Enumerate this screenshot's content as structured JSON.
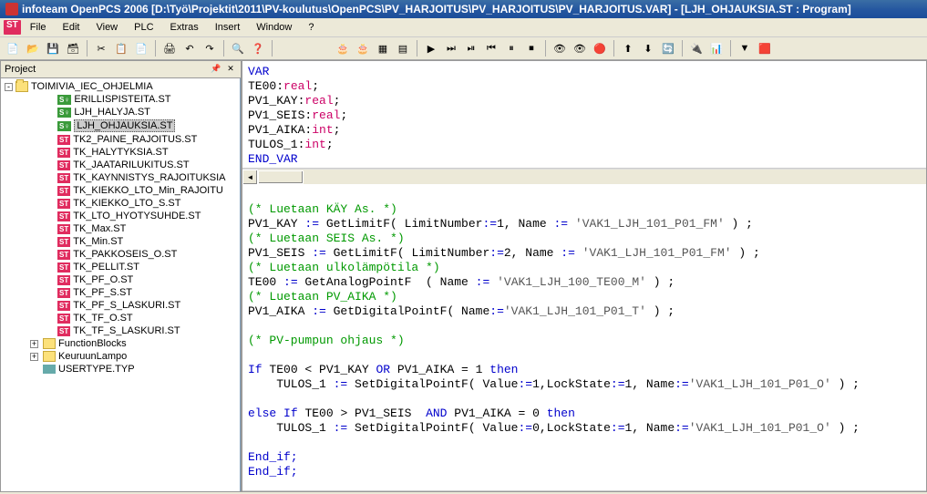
{
  "window": {
    "title": "infoteam OpenPCS 2006 [D:\\Työ\\Projektit\\2011\\PV-koulutus\\OpenPCS\\PV_HARJOITUS\\PV_HARJOITUS\\PV_HARJOITUS.VAR]  - [LJH_OHJAUKSIA.ST : Program]"
  },
  "menu": {
    "file": "File",
    "edit": "Edit",
    "view": "View",
    "plc": "PLC",
    "extras": "Extras",
    "insert": "Insert",
    "window": "Window",
    "help": "?"
  },
  "project": {
    "title": "Project",
    "root": "TOIMIVIA_IEC_OHJELMIA",
    "items": [
      {
        "icon": "sy",
        "label": "ERILLISPISTEITA.ST"
      },
      {
        "icon": "sy",
        "label": "LJH_HALYJA.ST"
      },
      {
        "icon": "sy",
        "label": "LJH_OHJAUKSIA.ST",
        "selected": true
      },
      {
        "icon": "st",
        "label": "TK2_PAINE_RAJOITUS.ST"
      },
      {
        "icon": "st",
        "label": "TK_HALYTYKSIA.ST"
      },
      {
        "icon": "st",
        "label": "TK_JAATARILUKITUS.ST"
      },
      {
        "icon": "st",
        "label": "TK_KAYNNISTYS_RAJOITUKSIA"
      },
      {
        "icon": "st",
        "label": "TK_KIEKKO_LTO_Min_RAJOITU"
      },
      {
        "icon": "st",
        "label": "TK_KIEKKO_LTO_S.ST"
      },
      {
        "icon": "st",
        "label": "TK_LTO_HYOTYSUHDE.ST"
      },
      {
        "icon": "st",
        "label": "TK_Max.ST"
      },
      {
        "icon": "st",
        "label": "TK_Min.ST"
      },
      {
        "icon": "st",
        "label": "TK_PAKKOSEIS_O.ST"
      },
      {
        "icon": "st",
        "label": "TK_PELLIT.ST"
      },
      {
        "icon": "st",
        "label": "TK_PF_O.ST"
      },
      {
        "icon": "st",
        "label": "TK_PF_S.ST"
      },
      {
        "icon": "st",
        "label": "TK_PF_S_LASKURI.ST"
      },
      {
        "icon": "st",
        "label": "TK_TF_O.ST"
      },
      {
        "icon": "st",
        "label": "TK_TF_S_LASKURI.ST"
      }
    ],
    "folders": [
      {
        "label": "FunctionBlocks"
      },
      {
        "label": "KeuruunLampo"
      }
    ],
    "bottom_item": "USERTYPE.TYP"
  },
  "code_top": {
    "l1": "VAR",
    "l2_a": "TE00:",
    "l2_b": "real",
    "l2_c": ";",
    "l3_a": "PV1_KAY:",
    "l3_b": "real",
    "l3_c": ";",
    "l4_a": "PV1_SEIS:",
    "l4_b": "real",
    "l4_c": ";",
    "l5_a": "PV1_AIKA:",
    "l5_b": "int",
    "l5_c": ";",
    "l6_a": "TULOS_1:",
    "l6_b": "int",
    "l6_c": ";",
    "l7": "END_VAR"
  },
  "code_bottom": {
    "c1": "(* Luetaan KÄY As. *)",
    "l1": "PV1_KAY := GetLimitF( LimitNumber:=1, Name := 'VAK1_LJH_101_P01_FM' ) ;",
    "c2": "(* Luetaan SEIS As. *)",
    "l2": "PV1_SEIS := GetLimitF( LimitNumber:=2, Name := 'VAK1_LJH_101_P01_FM' ) ;",
    "c3": "(* Luetaan ulkolämpötila *)",
    "l3": "TE00 := GetAnalogPointF  ( Name := 'VAK1_LJH_100_TE00_M' ) ;",
    "c4": "(* Luetaan PV_AIKA *)",
    "l4": "PV1_AIKA := GetDigitalPointF( Name:='VAK1_LJH_101_P01_T' ) ;",
    "c5": "(* PV-pumpun ohjaus *)",
    "l5": "If TE00 < PV1_KAY OR PV1_AIKA = 1 then",
    "l6": "    TULOS_1 := SetDigitalPointF( Value:=1,LockState:=1, Name:='VAK1_LJH_101_P01_O' ) ;",
    "l7": "else If TE00 > PV1_SEIS  AND PV1_AIKA = 0 then",
    "l8": "    TULOS_1 := SetDigitalPointF( Value:=0,LockState:=1, Name:='VAK1_LJH_101_P01_O' ) ;",
    "l9": "End_if;",
    "l10": "End_if;"
  }
}
